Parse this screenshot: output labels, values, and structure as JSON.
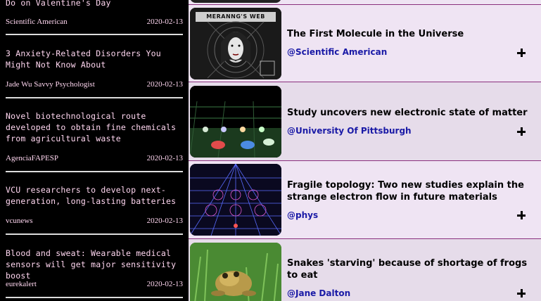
{
  "left_feed": [
    {
      "title": "Do on Valentine's Day",
      "source": "Scientific American",
      "date": "2020-02-13"
    },
    {
      "title": "3 Anxiety-Related Disorders You Might Not Know About",
      "source": "Jade Wu Savvy Psychologist",
      "date": "2020-02-13"
    },
    {
      "title": "Novel biotechnological route developed to obtain fine chemicals from agricultural waste",
      "source": "AgenciaFAPESP",
      "date": "2020-02-13"
    },
    {
      "title": "VCU researchers to develop next-generation, long-lasting batteries",
      "source": "vcunews",
      "date": "2020-02-13"
    },
    {
      "title": "Blood and sweat: Wearable medical sensors will get major sensitivity boost",
      "source": "eurekalert",
      "date": "2020-02-13"
    }
  ],
  "cards": [
    {
      "title": "The First Molecule in the Universe",
      "source": "@Scientific American",
      "thumb_text": "MERANNG'S WEB",
      "thumb_icon": "magazine-cover-thumbnail"
    },
    {
      "title": "Study uncovers new electronic state of matter",
      "source": "@University Of Pittsburgh",
      "thumb_icon": "glowing-lattice-thumbnail"
    },
    {
      "title": "Fragile topology: Two new studies explain the strange electron flow in future materials",
      "source": "@phys",
      "thumb_icon": "neon-grid-thumbnail"
    },
    {
      "title": "Snakes 'starving' because of shortage of frogs to eat",
      "source": "@Jane Dalton",
      "thumb_icon": "frog-in-grass-thumbnail"
    }
  ],
  "colors": {
    "left_bg": "#000000",
    "left_text": "#ffd6f0",
    "right_bg": "#efe4f3",
    "link": "#1a1aa6",
    "divider": "#8a2f7d"
  }
}
